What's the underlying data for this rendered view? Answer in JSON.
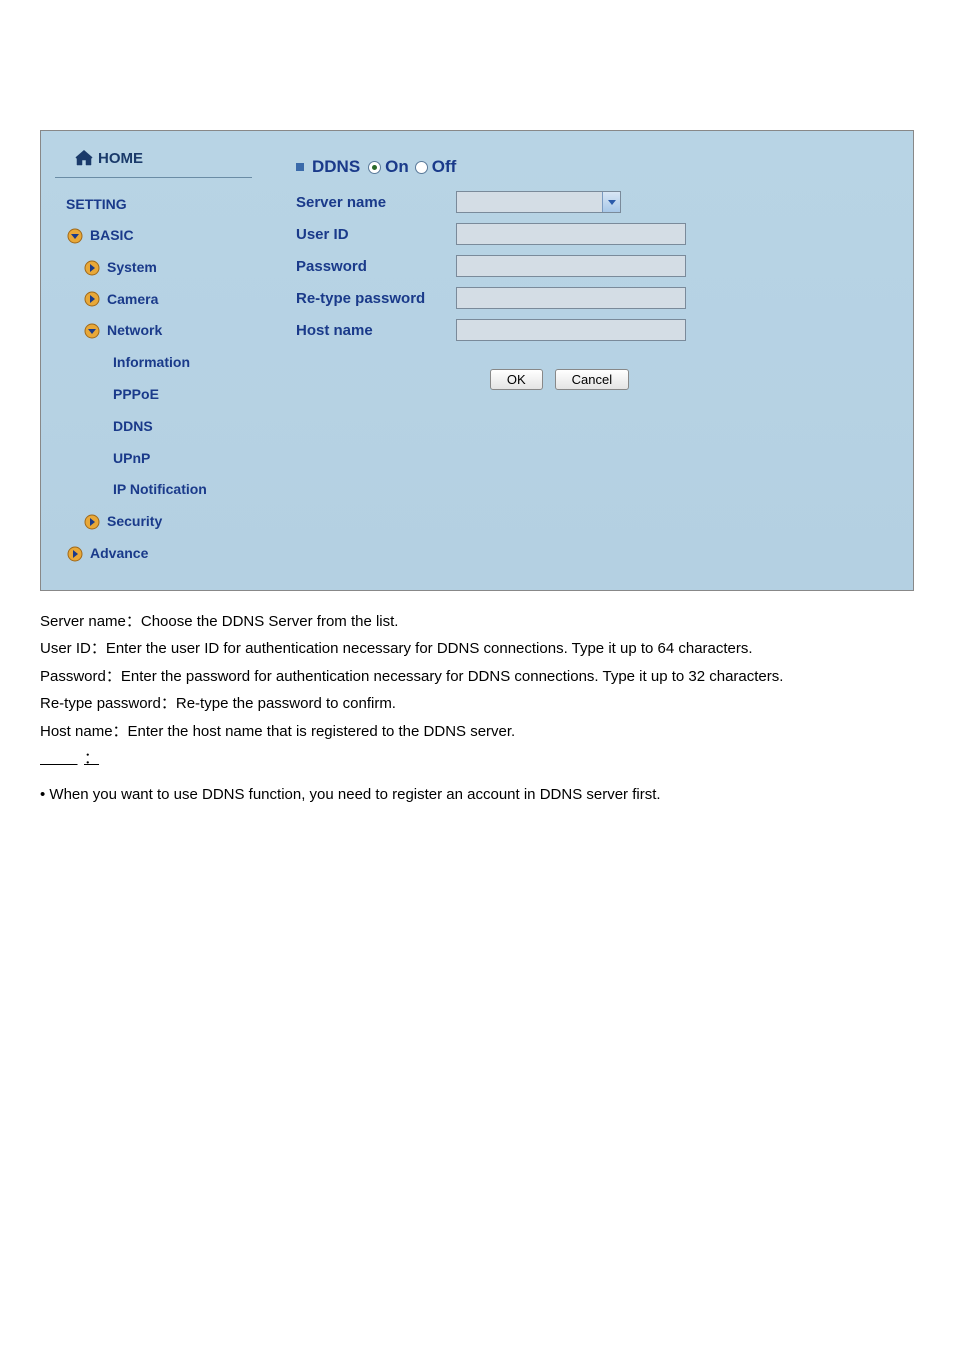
{
  "sidebar": {
    "home": "HOME",
    "setting": "SETTING",
    "basic": "BASIC",
    "system": "System",
    "camera": "Camera",
    "network": "Network",
    "information": "Information",
    "pppoe": "PPPoE",
    "ddns": "DDNS",
    "upnp": "UPnP",
    "ipnotification": "IP Notification",
    "security": "Security",
    "advance": "Advance"
  },
  "content": {
    "title": "DDNS",
    "radio_on": "On",
    "radio_off": "Off",
    "fields": {
      "server_name": "Server name",
      "user_id": "User ID",
      "password": "Password",
      "retype_password": "Re-type password",
      "host_name": "Host name"
    },
    "buttons": {
      "ok": "OK",
      "cancel": "Cancel"
    }
  },
  "desc": {
    "server_name": "Server name：Choose the DDNS Server from the list.",
    "user_id": "User ID：Enter the user ID for authentication necessary for DDNS connections. Type it up to 64 characters.",
    "password": "Password：Enter the password for authentication necessary for DDNS connections. Type it up to 32 characters.",
    "retype": "Re-type password：Re-type the password to confirm.",
    "host_name": "Host name：Enter the host name that is registered to the DDNS server.",
    "note": "• When you want to use DDNS function, you need to register an account in DDNS server first."
  }
}
